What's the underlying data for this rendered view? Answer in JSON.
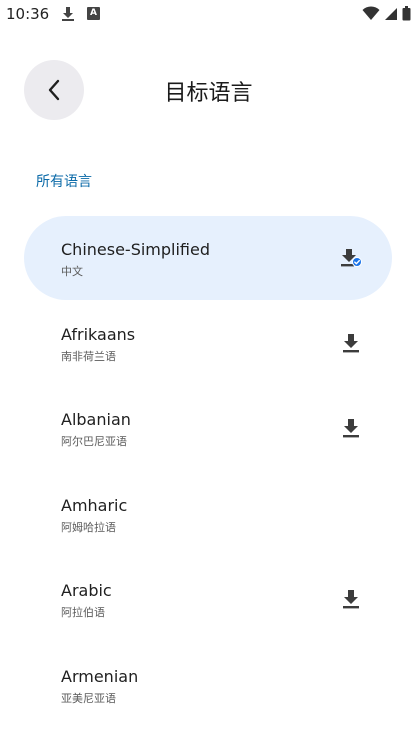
{
  "status_bar": {
    "time": "10:36",
    "notification_badge": "A"
  },
  "header": {
    "title": "目标语言"
  },
  "section": {
    "label": "所有语言"
  },
  "languages": [
    {
      "name": "Chinese-Simplified",
      "native": "中文",
      "selected": true,
      "download_state": "downloaded"
    },
    {
      "name": "Afrikaans",
      "native": "南非荷兰语",
      "selected": false,
      "download_state": "available"
    },
    {
      "name": "Albanian",
      "native": "阿尔巴尼亚语",
      "selected": false,
      "download_state": "available"
    },
    {
      "name": "Amharic",
      "native": "阿姆哈拉语",
      "selected": false,
      "download_state": "none"
    },
    {
      "name": "Arabic",
      "native": "阿拉伯语",
      "selected": false,
      "download_state": "available"
    },
    {
      "name": "Armenian",
      "native": "亚美尼亚语",
      "selected": false,
      "download_state": "none"
    }
  ],
  "colors": {
    "accent": "#0b6aa8",
    "selected_bg": "#e6f0fd",
    "back_button_bg": "#ecebef",
    "check_badge": "#1a73e8"
  },
  "icons": {
    "back": "arrow-back-icon",
    "download": "download-icon",
    "downloaded": "download-done-icon"
  }
}
